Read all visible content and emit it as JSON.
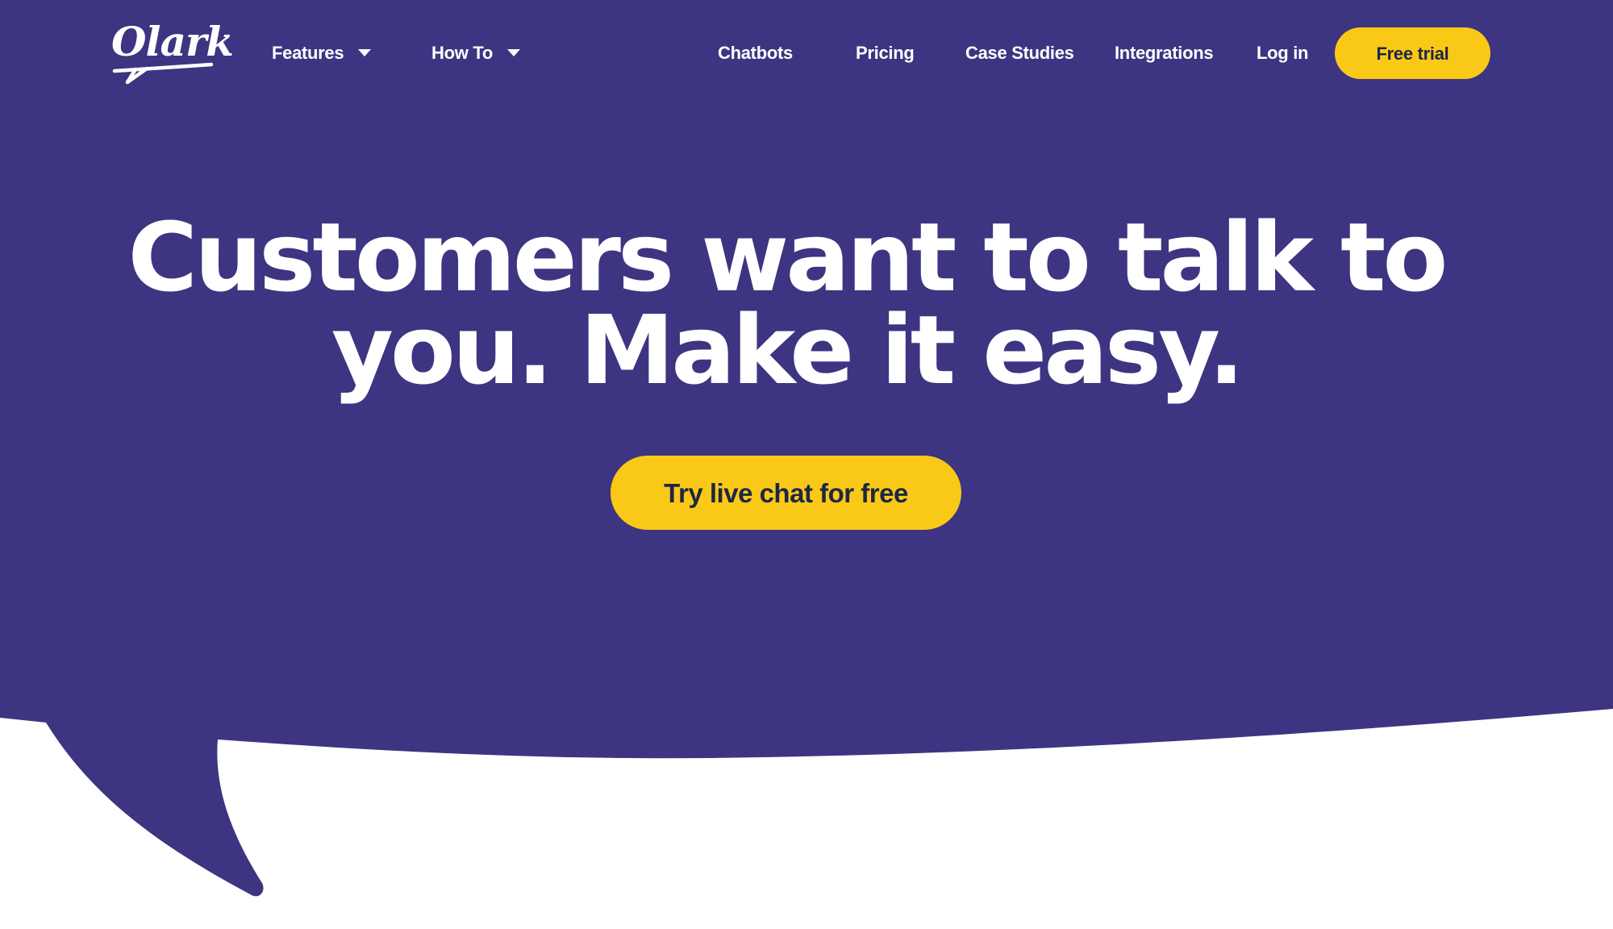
{
  "brand": {
    "logo_text": "Olark",
    "colors": {
      "primary_purple": "#3d3581",
      "accent_yellow": "#fac917",
      "button_text": "#1e2744",
      "nav_text": "#ffffff"
    }
  },
  "nav": {
    "left_items": [
      {
        "label": "Features",
        "has_dropdown": true,
        "icon": "caret-down-icon"
      },
      {
        "label": "How To",
        "has_dropdown": true,
        "icon": "caret-down-icon"
      }
    ],
    "right_items": [
      {
        "label": "Chatbots"
      },
      {
        "label": "Pricing"
      },
      {
        "label": "Case Studies"
      },
      {
        "label": "Integrations"
      },
      {
        "label": "Log in"
      }
    ],
    "cta_label": "Free trial"
  },
  "hero": {
    "headline_line1": "Customers want to talk to",
    "headline_line2": "you. Make it easy.",
    "cta_label": "Try live chat for free"
  }
}
